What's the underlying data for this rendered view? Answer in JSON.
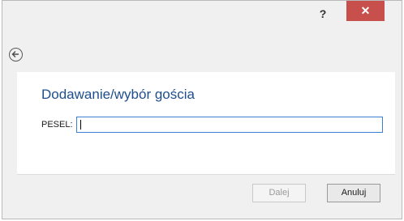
{
  "titlebar": {
    "help_label": "?",
    "close_label": "✕",
    "close_color": "#c7504d"
  },
  "navigation": {
    "back_icon": "back-arrow-icon"
  },
  "form": {
    "heading": "Dodawanie/wybór gościa",
    "pesel_label": "PESEL:",
    "pesel_value": ""
  },
  "footer": {
    "next_label": "Dalej",
    "next_enabled": false,
    "cancel_label": "Anuluj"
  },
  "colors": {
    "heading": "#1f4e8c",
    "input_focus_border": "#3c7fd1"
  }
}
